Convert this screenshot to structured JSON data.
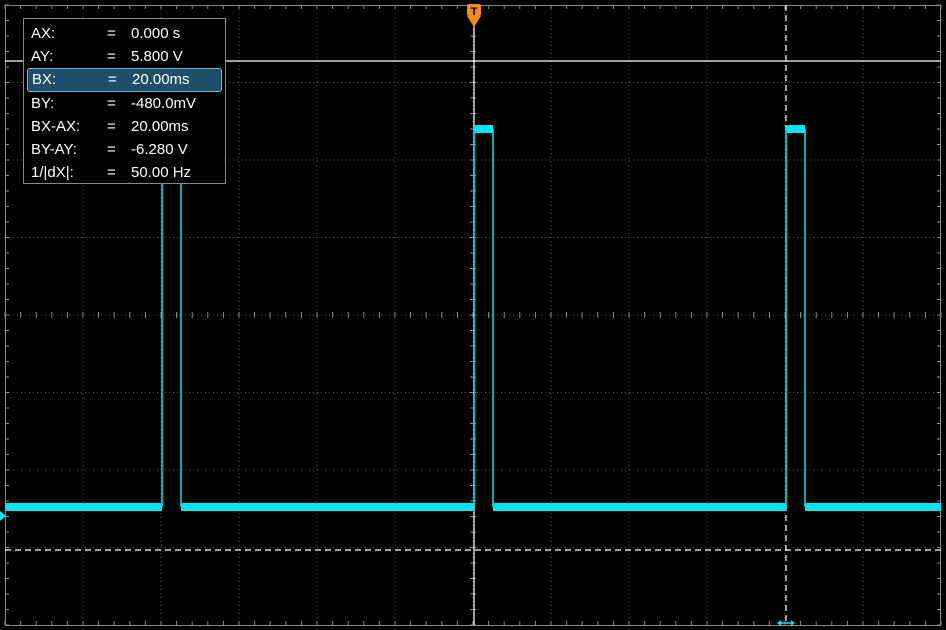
{
  "cursor_readout": {
    "rows": [
      {
        "label": "AX:",
        "eq": "=",
        "value": "0.000 s",
        "selected": false
      },
      {
        "label": "AY:",
        "eq": "=",
        "value": "5.800 V",
        "selected": false
      },
      {
        "label": "BX:",
        "eq": "=",
        "value": "20.00ms",
        "selected": true
      },
      {
        "label": "BY:",
        "eq": "=",
        "value": "-480.0mV",
        "selected": false
      },
      {
        "label": "BX-AX:",
        "eq": "=",
        "value": "20.00ms",
        "selected": false
      },
      {
        "label": "BY-AY:",
        "eq": "=",
        "value": "-6.280 V",
        "selected": false
      },
      {
        "label": "1/|dX|:",
        "eq": "=",
        "value": "50.00 Hz",
        "selected": false
      }
    ]
  },
  "colors": {
    "background": "#000000",
    "trace": "#00e5ee",
    "grid": "#5a5a5a",
    "cursor": "#ffffff",
    "trigger_marker": "#f28c1c",
    "panel_border": "#8a8a8a",
    "selected_row": "#1f4e6b"
  },
  "icons": {
    "trigger_position": "trigger-position-marker-icon",
    "ground_level": "ground-level-marker-icon",
    "cursor_b_handle": "cursor-b-handle-icon"
  }
}
